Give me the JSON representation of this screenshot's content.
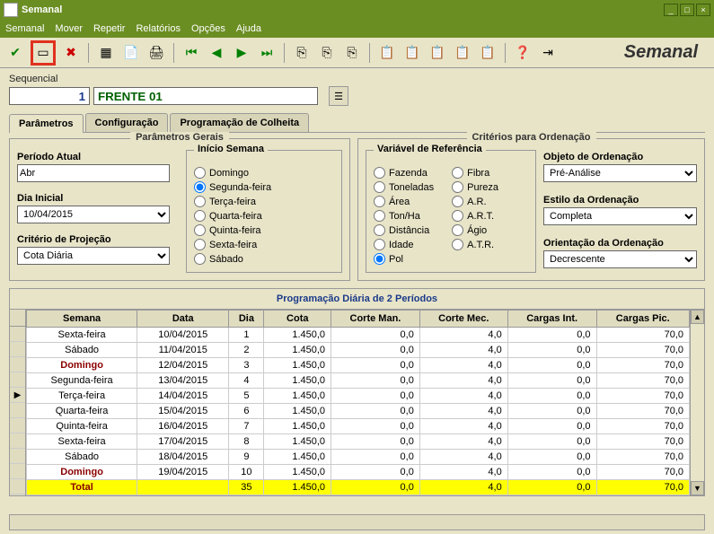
{
  "window": {
    "title": "Semanal",
    "brand": "Semanal"
  },
  "menu": [
    "Semanal",
    "Mover",
    "Repetir",
    "Relatórios",
    "Opções",
    "Ajuda"
  ],
  "sequencial": {
    "label": "Sequencial",
    "num": "1",
    "name": "FRENTE 01"
  },
  "tabs": [
    "Parâmetros",
    "Configuração",
    "Programação de Colheita"
  ],
  "panel_left_title": "Parâmetros Gerais",
  "panel_right_title": "Critérios para Ordenação",
  "periodo_atual": {
    "label": "Período Atual",
    "value": "Abr"
  },
  "dia_inicial": {
    "label": "Dia Inicial",
    "value": "10/04/2015"
  },
  "criterio_proj": {
    "label": "Critério de Projeção",
    "value": "Cota Diária"
  },
  "inicio_semana": {
    "title": "Início Semana",
    "options": [
      "Domingo",
      "Segunda-feira",
      "Terça-feira",
      "Quarta-feira",
      "Quinta-feira",
      "Sexta-feira",
      "Sábado"
    ],
    "selected": 1
  },
  "variavel_ref": {
    "title": "Variável de Referência",
    "col1": [
      "Fazenda",
      "Toneladas",
      "Área",
      "Ton/Ha",
      "Distância",
      "Idade",
      "Pol"
    ],
    "col2": [
      "Fibra",
      "Pureza",
      "A.R.",
      "A.R.T.",
      "Ágio",
      "A.T.R."
    ],
    "selected": "Pol"
  },
  "objeto_ord": {
    "label": "Objeto de Ordenação",
    "value": "Pré-Análise"
  },
  "estilo_ord": {
    "label": "Estilo da Ordenação",
    "value": "Completa"
  },
  "orient_ord": {
    "label": "Orientação da Ordenação",
    "value": "Decrescente"
  },
  "grid": {
    "title": "Programação Diária de 2 Períodos",
    "headers": [
      "Semana",
      "Data",
      "Dia",
      "Cota",
      "Corte Man.",
      "Corte Mec.",
      "Cargas Int.",
      "Cargas Pic."
    ],
    "rows": [
      {
        "sem": "Sexta-feira",
        "data": "10/04/2015",
        "dia": "1",
        "cota": "1.450,0",
        "cman": "0,0",
        "cmec": "4,0",
        "cint": "0,0",
        "cpic": "70,0",
        "sunday": false,
        "cur": false
      },
      {
        "sem": "Sábado",
        "data": "11/04/2015",
        "dia": "2",
        "cota": "1.450,0",
        "cman": "0,0",
        "cmec": "4,0",
        "cint": "0,0",
        "cpic": "70,0",
        "sunday": false,
        "cur": false
      },
      {
        "sem": "Domingo",
        "data": "12/04/2015",
        "dia": "3",
        "cota": "1.450,0",
        "cman": "0,0",
        "cmec": "4,0",
        "cint": "0,0",
        "cpic": "70,0",
        "sunday": true,
        "cur": false
      },
      {
        "sem": "Segunda-feira",
        "data": "13/04/2015",
        "dia": "4",
        "cota": "1.450,0",
        "cman": "0,0",
        "cmec": "4,0",
        "cint": "0,0",
        "cpic": "70,0",
        "sunday": false,
        "cur": false
      },
      {
        "sem": "Terça-feira",
        "data": "14/04/2015",
        "dia": "5",
        "cota": "1.450,0",
        "cman": "0,0",
        "cmec": "4,0",
        "cint": "0,0",
        "cpic": "70,0",
        "sunday": false,
        "cur": true
      },
      {
        "sem": "Quarta-feira",
        "data": "15/04/2015",
        "dia": "6",
        "cota": "1.450,0",
        "cman": "0,0",
        "cmec": "4,0",
        "cint": "0,0",
        "cpic": "70,0",
        "sunday": false,
        "cur": false
      },
      {
        "sem": "Quinta-feira",
        "data": "16/04/2015",
        "dia": "7",
        "cota": "1.450,0",
        "cman": "0,0",
        "cmec": "4,0",
        "cint": "0,0",
        "cpic": "70,0",
        "sunday": false,
        "cur": false
      },
      {
        "sem": "Sexta-feira",
        "data": "17/04/2015",
        "dia": "8",
        "cota": "1.450,0",
        "cman": "0,0",
        "cmec": "4,0",
        "cint": "0,0",
        "cpic": "70,0",
        "sunday": false,
        "cur": false
      },
      {
        "sem": "Sábado",
        "data": "18/04/2015",
        "dia": "9",
        "cota": "1.450,0",
        "cman": "0,0",
        "cmec": "4,0",
        "cint": "0,0",
        "cpic": "70,0",
        "sunday": false,
        "cur": false
      },
      {
        "sem": "Domingo",
        "data": "19/04/2015",
        "dia": "10",
        "cota": "1.450,0",
        "cman": "0,0",
        "cmec": "4,0",
        "cint": "0,0",
        "cpic": "70,0",
        "sunday": true,
        "cur": false
      }
    ],
    "total": {
      "label": "Total",
      "dia": "35",
      "cota": "1.450,0",
      "cman": "0,0",
      "cmec": "4,0",
      "cint": "0,0",
      "cpic": "70,0"
    }
  }
}
